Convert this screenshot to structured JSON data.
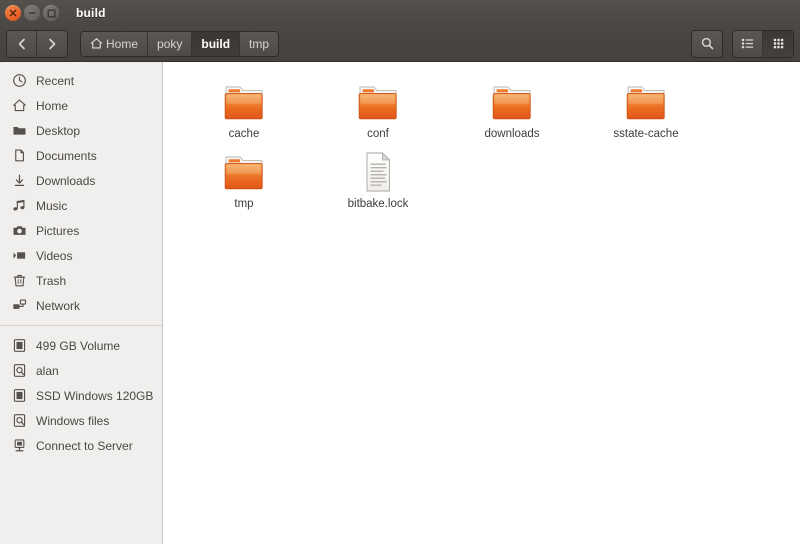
{
  "window": {
    "title": "build",
    "controls": [
      {
        "name": "close",
        "label": "Close"
      },
      {
        "name": "minimize",
        "label": "Minimize"
      },
      {
        "name": "maximize",
        "label": "Maximize"
      }
    ]
  },
  "toolbar": {
    "back_label": "Back",
    "forward_label": "Forward",
    "search_label": "Search",
    "list_view_label": "List view",
    "grid_view_label": "Icon view",
    "active_view": "grid",
    "breadcrumbs": [
      {
        "label": "Home",
        "icon": "home-icon",
        "active": false
      },
      {
        "label": "poky",
        "icon": "",
        "active": false
      },
      {
        "label": "build",
        "icon": "",
        "active": true
      },
      {
        "label": "tmp",
        "icon": "",
        "active": false
      }
    ]
  },
  "sidebar": {
    "places": [
      {
        "label": "Recent",
        "icon": "clock-icon"
      },
      {
        "label": "Home",
        "icon": "home-icon"
      },
      {
        "label": "Desktop",
        "icon": "desktop-folder-icon"
      },
      {
        "label": "Documents",
        "icon": "document-icon"
      },
      {
        "label": "Downloads",
        "icon": "download-arrow-icon"
      },
      {
        "label": "Music",
        "icon": "music-note-icon"
      },
      {
        "label": "Pictures",
        "icon": "camera-icon"
      },
      {
        "label": "Videos",
        "icon": "video-icon"
      },
      {
        "label": "Trash",
        "icon": "trash-icon"
      },
      {
        "label": "Network",
        "icon": "network-icon"
      }
    ],
    "devices": [
      {
        "label": "499 GB Volume",
        "icon": "harddisk-icon"
      },
      {
        "label": "alan",
        "icon": "remote-volume-icon"
      },
      {
        "label": "SSD Windows 120GB",
        "icon": "harddisk-icon"
      },
      {
        "label": "Windows files",
        "icon": "remote-volume-icon"
      },
      {
        "label": "Connect to Server",
        "icon": "server-icon"
      }
    ]
  },
  "main": {
    "items": [
      {
        "label": "cache",
        "type": "folder"
      },
      {
        "label": "conf",
        "type": "folder"
      },
      {
        "label": "downloads",
        "type": "folder"
      },
      {
        "label": "sstate-cache",
        "type": "folder"
      },
      {
        "label": "tmp",
        "type": "folder"
      },
      {
        "label": "bitbake.lock",
        "type": "file"
      }
    ]
  },
  "colors": {
    "titlebar": "#4b4744",
    "toolbar": "#45413e",
    "sidebar_bg": "#f0efed",
    "main_bg": "#ffffff",
    "folder_orange": "#e8621f",
    "close_button": "#e8642a"
  }
}
